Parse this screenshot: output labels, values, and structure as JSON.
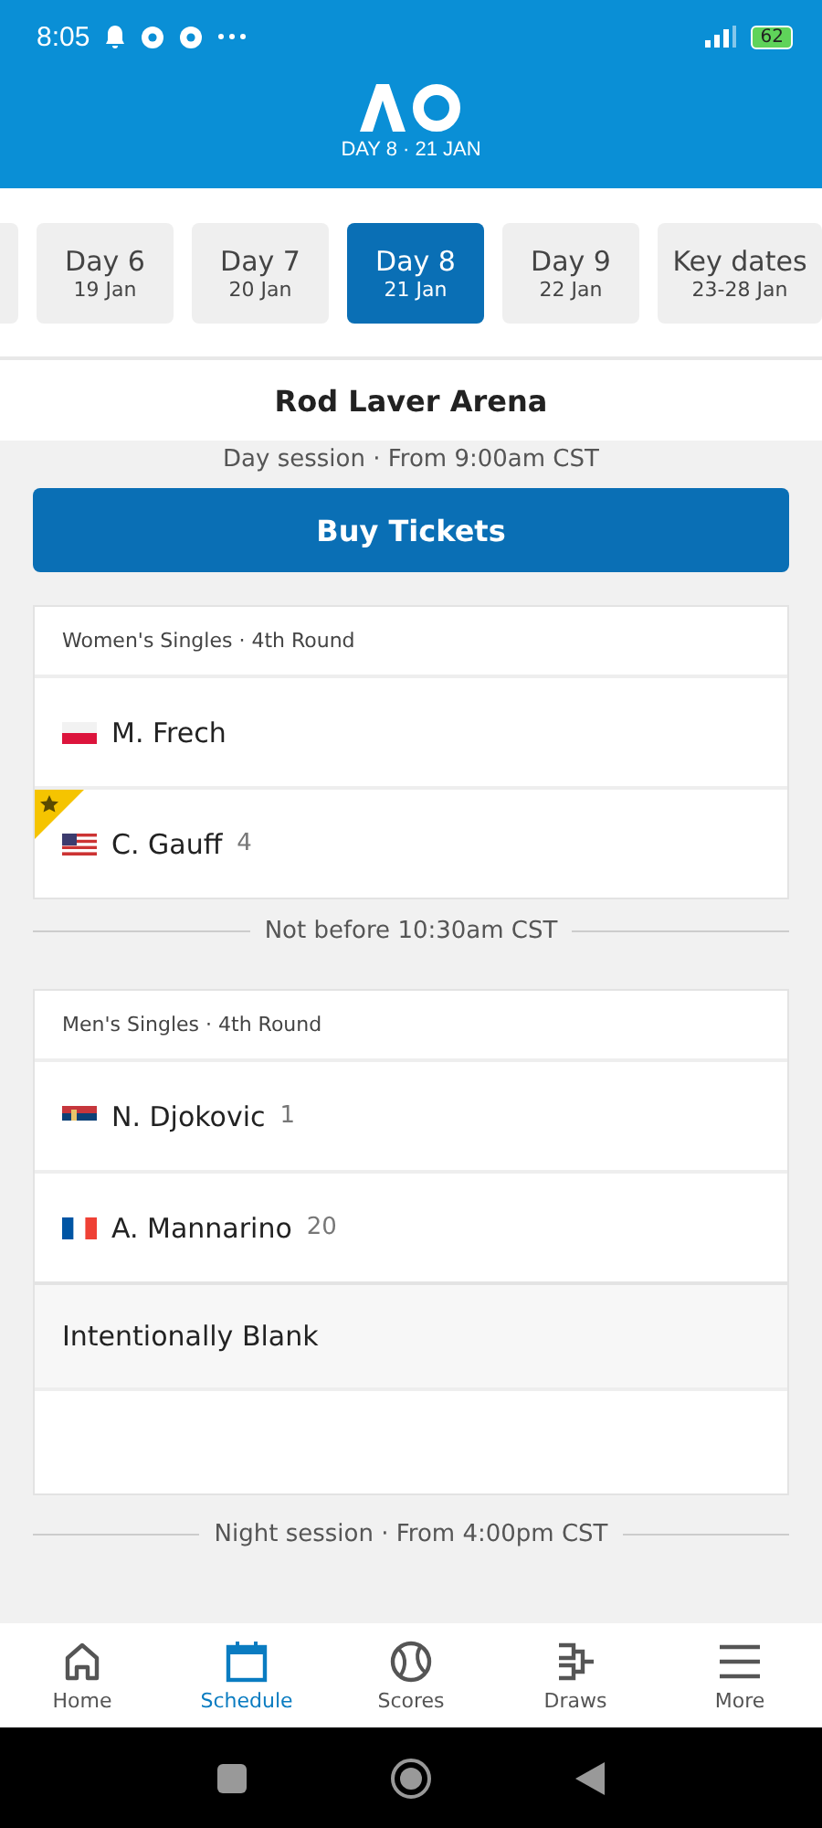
{
  "status_bar": {
    "time": "8:05",
    "battery": "62"
  },
  "header": {
    "subtitle": "DAY 8 · 21 JAN"
  },
  "day_tabs": [
    {
      "selected": false,
      "kind": "stub"
    },
    {
      "label": "Day 6",
      "date": "19 Jan",
      "selected": false,
      "kind": "day"
    },
    {
      "label": "Day 7",
      "date": "20 Jan",
      "selected": false,
      "kind": "day"
    },
    {
      "label": "Day 8",
      "date": "21 Jan",
      "selected": true,
      "kind": "day"
    },
    {
      "label": "Day 9",
      "date": "22 Jan",
      "selected": false,
      "kind": "day"
    },
    {
      "label": "Key dates",
      "date": "23-28 Jan",
      "selected": false,
      "kind": "day"
    }
  ],
  "court": "Rod Laver Arena",
  "sections": [
    {
      "kind": "session",
      "text": "Day session · From 9:00am CST"
    },
    {
      "kind": "button",
      "text": "Buy Tickets"
    },
    {
      "kind": "match",
      "event": "Women's Singles · 4th Round",
      "players": [
        {
          "name": "M. Frech",
          "kind": "poland",
          "favorite": false
        },
        {
          "name": "C. Gauff",
          "seed": "4",
          "kind": "usa",
          "favorite": true
        }
      ]
    },
    {
      "kind": "divider",
      "text": "Not before 10:30am CST"
    },
    {
      "kind": "match",
      "event": "Men's Singles · 4th Round",
      "players": [
        {
          "name": "N. Djokovic",
          "seed": "1",
          "kind": "serbia",
          "favorite": false
        },
        {
          "name": "A. Mannarino",
          "seed": "20",
          "kind": "france",
          "favorite": false
        }
      ]
    },
    {
      "kind": "blank",
      "text": "Intentionally Blank"
    },
    {
      "kind": "divider",
      "text": "Night session · From 4:00pm CST"
    }
  ],
  "bottom_nav": [
    {
      "label": "Home",
      "selected": false
    },
    {
      "label": "Schedule",
      "selected": true
    },
    {
      "label": "Scores",
      "selected": false
    },
    {
      "label": "Draws",
      "selected": false
    },
    {
      "label": "More",
      "selected": false
    }
  ]
}
